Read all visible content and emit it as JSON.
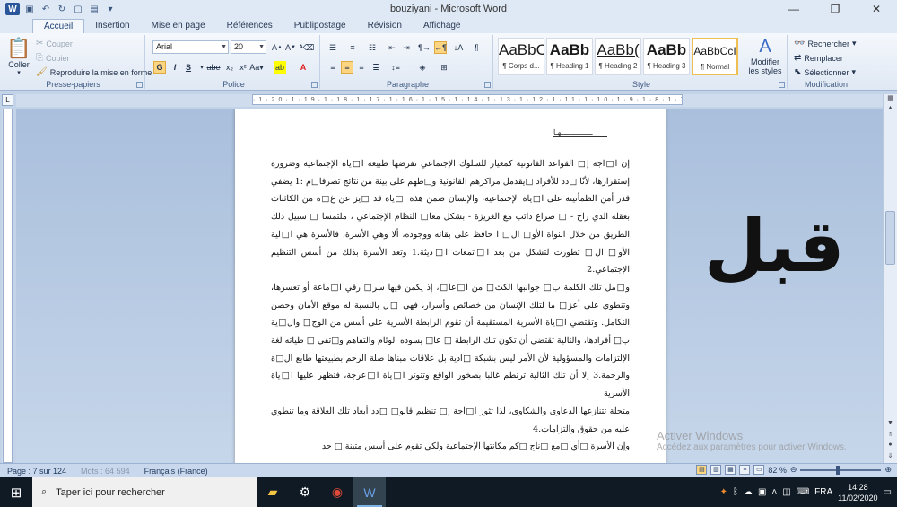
{
  "window": {
    "title": "bouziyani - Microsoft Word",
    "minimize": "—",
    "maximize": "❐",
    "close": "✕"
  },
  "tabs": [
    "Accueil",
    "Insertion",
    "Mise en page",
    "Références",
    "Publipostage",
    "Révision",
    "Affichage"
  ],
  "ribbon": {
    "clipboard": {
      "label": "Presse-papiers",
      "paste": "Coller",
      "cut": "Couper",
      "copy": "Copier",
      "format_painter": "Reproduire la mise en forme"
    },
    "font": {
      "label": "Police",
      "font_name": "Arial",
      "font_size": "20"
    },
    "paragraph": {
      "label": "Paragraphe"
    },
    "styles": {
      "label": "Style",
      "items": [
        {
          "preview": "AaBbC",
          "name": "¶ Corps d..."
        },
        {
          "preview": "AaBb",
          "name": "¶ Heading 1"
        },
        {
          "preview": "AaBb(",
          "name": "¶ Heading 2"
        },
        {
          "preview": "AaBb",
          "name": "¶ Heading 3"
        },
        {
          "preview": "AaBbCcI",
          "name": "¶ Normal"
        }
      ],
      "change_styles": "Modifier les styles"
    },
    "editing": {
      "label": "Modification",
      "find": "Rechercher",
      "replace": "Remplacer",
      "select": "Sélectionner"
    }
  },
  "ruler_text": "·1·20·1·19·1·18·1·17·1·16·1·15·1·14·1·13·1·12·1·11·1·10·1·9·1·8·1·7·1·6·1·5·1·4·1·3·1·2·1·1·1·",
  "document": {
    "header_mark": "ـــــــــــــــهـا",
    "paragraphs": [
      "إن ا□اجة إ□ القواعد القانونية كمعيار للسلوك الإجتماعي تفرضها طبيعة ا□ياة الإجتماعية وضرورة إستقرارها، لأنّا □دد للأفراد □يقدمل مراكزهم القانونية و□طهم على بينة من نتائج تصرفا□م :1 يضفي قدر أمن الطمأنينة على ا□ياة الإجتماعية، والإنسان ضمن هذه ا□ياة قد □يز عن غ□ه من الكائنات بعقله الذي راح - □ صراع دائب مع الغريزة - بشكل معا□ النظام الإجتماعي ، ملتمسا □ سبيل ذلك الطريق من خلال النواة الأو□ ال□ ا حافظ على بقائه ووجوده، ألا وهي الأسرة، فالأسرة هي ا□لية الأو□ ال□ تطورت لتشكل من بعد ا□تمعات ا□ديثة.1 وتعد الأسرة بذلك من أسس التنظيم الإجتماعي.2",
      "و□مل تلك الكلمة ب□ جوانبها الكث□ من ا□عا□، إذ يكمن فيها سر□ رقي ا□ماعة أو تعسرها، وتنطوي على أعز□ ما لتلك الإنسان من خصائص وأسرار، فهي □ل بالنسبة له موقع الأمان وحصن التكامل. وتقتضي ا□ياة الأسرية المستقيمة أن تقوم الرابطة الأسرية على أسس من الوج□ وال□ية ب□ أفرادها، والتالية تقتضي أن تكون تلك الرابطة □ عا□ يسوده الوئام والتفاهم و□تفي □ طياته لغة الإلتزامات والمسؤولية لأن الأمر ليس بشبكة □ادية بل علاقات مبناها صلة الرحم بطبيعتها طابع ال□ة والرحمة.3 إلا أن تلك الثالية ترتطم غالبا بصخور الواقع وتتوتر ا□ياة ا□عرجة، فتظهر عليها ا□ياة الأسرية",
      "متحلة تتنازعها الدعاوى والشكاوى، لذا تثور ا□اجة إ□ تنظيم قانو□ □دد أبعاد تلك العلاقة وما تنطوي عليه من حقوق والتزامات.4",
      "وإن الأسرة □أي □مع □ناج □كم مكانتها الإجتماعية ولكي تقوم على أسس متينة □ حد"
    ]
  },
  "overlay_word": "قبل",
  "activation": {
    "title": "Activer Windows",
    "subtitle": "Accédez aux paramètres pour activer Windows."
  },
  "statusbar": {
    "page": "Page : 7 sur 124",
    "words": "Mots : 64 594",
    "language": "Français (France)",
    "zoom": "82 %"
  },
  "taskbar": {
    "search_placeholder": "Taper ici pour rechercher",
    "language": "FRA",
    "time": "14:28",
    "date": "11/02/2020"
  }
}
